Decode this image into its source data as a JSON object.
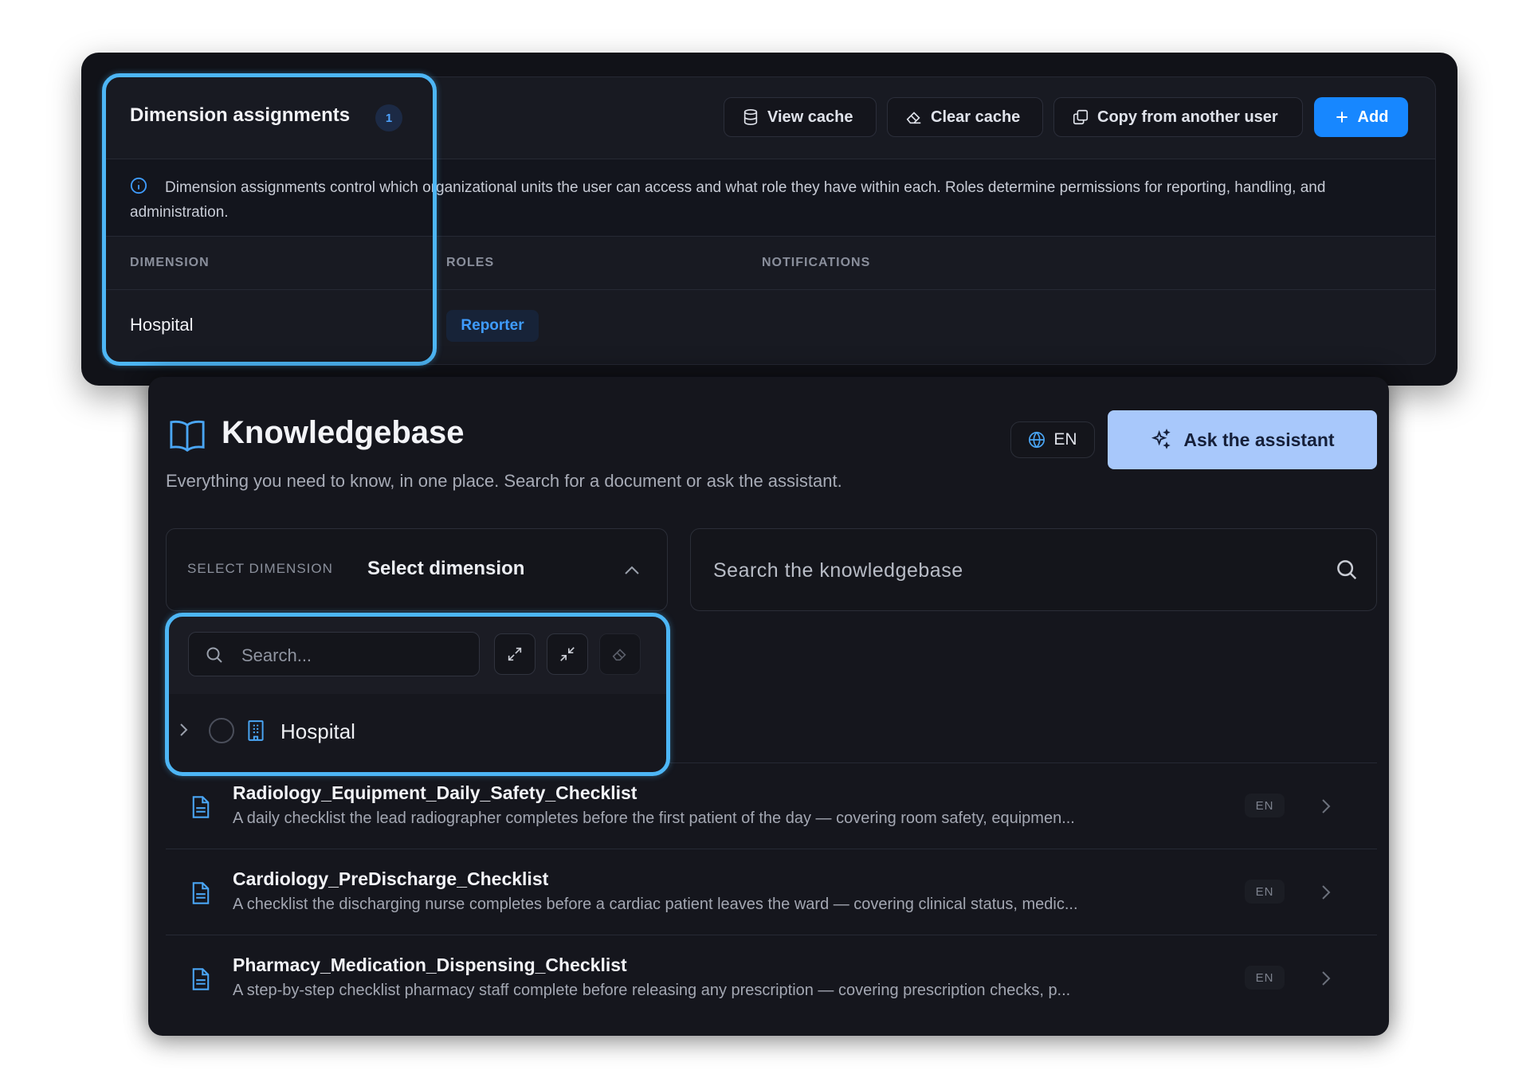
{
  "dimension_assignments": {
    "title": "Dimension assignments",
    "count": "1",
    "buttons": {
      "view_cache": "View cache",
      "clear_cache": "Clear cache",
      "copy_from_user": "Copy from another user",
      "add": "Add"
    },
    "info_text": "Dimension assignments control which organizational units the user can access and what role they have within each. Roles determine permissions for reporting, handling, and administration.",
    "columns": [
      "DIMENSION",
      "ROLES",
      "NOTIFICATIONS"
    ],
    "rows": [
      {
        "dimension": "Hospital",
        "role": "Reporter",
        "notifications": ""
      }
    ]
  },
  "knowledgebase": {
    "title": "Knowledgebase",
    "subtitle": "Everything you need to know, in one place. Search for a document or ask the assistant.",
    "language": "EN",
    "assistant_button": "Ask the assistant",
    "select_dimension": {
      "label": "SELECT DIMENSION",
      "value": "Select dimension"
    },
    "search_placeholder": "Search the knowledgebase",
    "dropdown": {
      "search_placeholder": "Search...",
      "tree_items": [
        {
          "label": "Hospital"
        }
      ]
    },
    "documents": [
      {
        "title": "Radiology_Equipment_Daily_Safety_Checklist",
        "description": "A daily checklist the lead radiographer completes before the first patient of the day — covering room safety, equipmen...",
        "lang": "EN"
      },
      {
        "title": "Cardiology_PreDischarge_Checklist",
        "description": "A checklist the discharging nurse completes before a cardiac patient leaves the ward — covering clinical status, medic...",
        "lang": "EN"
      },
      {
        "title": "Pharmacy_Medication_Dispensing_Checklist",
        "description": "A step-by-step checklist pharmacy staff complete before releasing any prescription — covering prescription checks, p...",
        "lang": "EN"
      }
    ]
  },
  "colors": {
    "highlight": "#4db6f5",
    "accent": "#1787ff",
    "assistant_button": "#a8c8fb"
  },
  "icons": [
    "database-icon",
    "eraser-icon",
    "copy-icon",
    "plus-icon",
    "info-icon",
    "book-icon",
    "globe-icon",
    "sparkles-icon",
    "chevron-up-icon",
    "search-icon",
    "expand-icon",
    "collapse-icon",
    "chevron-right-icon",
    "building-icon",
    "document-icon"
  ]
}
